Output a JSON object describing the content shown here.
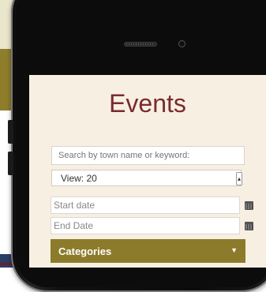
{
  "page": {
    "title": "Events"
  },
  "search": {
    "placeholder": "Search by town name or keyword:"
  },
  "view_select": {
    "selected": "View: 20"
  },
  "dates": {
    "start_placeholder": "Start date",
    "end_placeholder": "End Date"
  },
  "categories": {
    "label": "Categories"
  },
  "icons": {
    "speaker": "speaker-grille-icon",
    "camera": "camera-icon",
    "calendar": "calendar-icon",
    "dropdown": "caret-down-icon"
  },
  "colors": {
    "title": "#7a2a2f",
    "accent": "#8d7b2c",
    "screen_bg": "#f7efe2",
    "page_top": "#e9e6cb"
  }
}
